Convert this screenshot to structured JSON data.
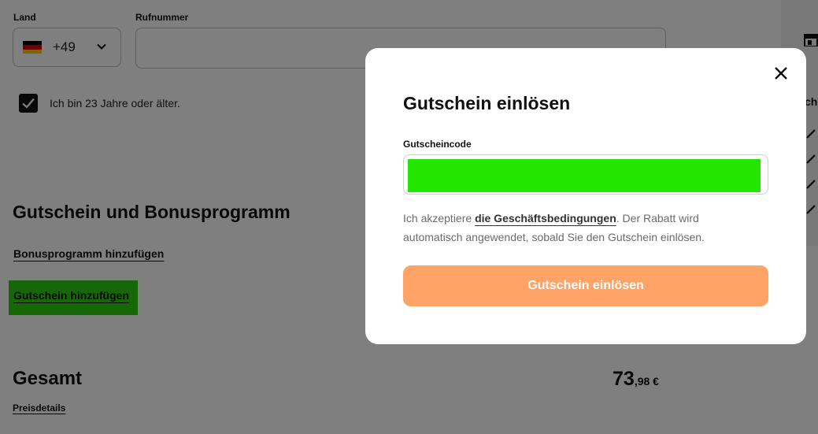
{
  "form": {
    "country_label": "Land",
    "country_code": "+49",
    "phone_label": "Rufnummer",
    "phone_value": "",
    "age_confirmation": "Ich bin 23 Jahre oder älter.",
    "age_checked": true
  },
  "voucher_section": {
    "title": "Gutschein und Bonusprogramm",
    "bonus_link": "Bonusprogramm hinzufügen",
    "voucher_link": "Gutschein hinzufügen"
  },
  "total": {
    "label": "Gesamt",
    "amount_integer": "73",
    "amount_decimal": ",98 €",
    "price_details_link": "Preisdetails"
  },
  "side_panel": {
    "text": "ch"
  },
  "modal": {
    "title": "Gutschein einlösen",
    "field_label": "Gutscheincode",
    "code_value": "",
    "terms_prefix": "Ich akzeptiere ",
    "terms_link": "die Geschäftsbedingungen",
    "terms_suffix": ". Der Rabatt wird automatisch angewendet, sobald Sie den Gutschein einlösen.",
    "submit_label": "Gutschein einlösen"
  },
  "colors": {
    "primary_button": "#ffa366",
    "highlight": "#22e600",
    "overlay": "rgba(0,0,0,0.5)"
  },
  "icons": {
    "close": "close-icon",
    "chevron": "chevron-down-icon",
    "checkbox": "checkmark-icon",
    "flag": "flag-germany-icon",
    "store": "store-icon"
  }
}
